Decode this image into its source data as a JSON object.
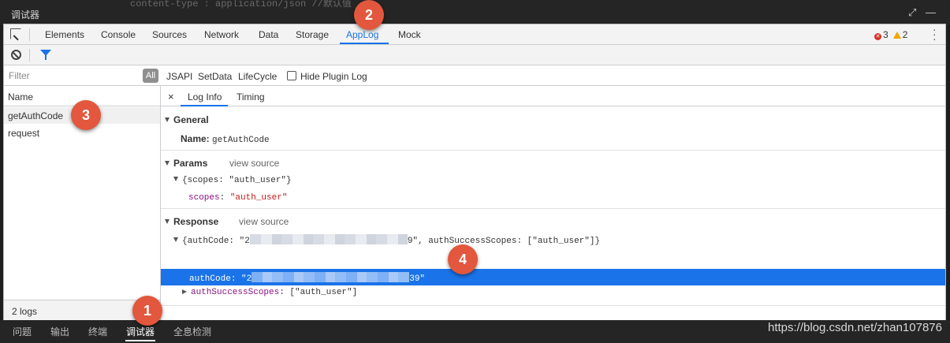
{
  "window": {
    "title": "调试器",
    "code_snippet": "content-type :  application/json  //默认值",
    "controls": [
      "expand-icon",
      "minimize-icon"
    ]
  },
  "devtools_tabs": [
    "Elements",
    "Console",
    "Sources",
    "Network",
    "Data",
    "Storage",
    "AppLog",
    "Mock"
  ],
  "active_tab": "AppLog",
  "status": {
    "errors": "3",
    "warnings": "2"
  },
  "filter": {
    "placeholder": "Filter",
    "all_label": "All",
    "types": [
      "JSAPI",
      "SetData",
      "LifeCycle"
    ],
    "hide_plugin_label": "Hide Plugin Log",
    "hide_plugin_checked": false
  },
  "list": {
    "header": "Name",
    "items": [
      "getAuthCode",
      "request"
    ],
    "selected": "getAuthCode",
    "footer": "2 logs"
  },
  "detail": {
    "close": "×",
    "tabs": [
      "Log Info",
      "Timing"
    ],
    "active_tab": "Log Info",
    "general": {
      "title": "General",
      "name_label": "Name:",
      "name_value": "getAuthCode"
    },
    "params": {
      "title": "Params",
      "view_source": "view source",
      "summary": "{scopes: \"auth_user\"}",
      "key": "scopes",
      "value": "\"auth_user\""
    },
    "response": {
      "title": "Response",
      "view_source": "view source",
      "summary_prefix": "{authCode: \"2",
      "summary_suffix": "9\", authSuccessScopes: [\"auth_user\"]}",
      "authcode_key": "authCode",
      "authcode_prefix": "\"2",
      "authcode_suffix": "39\"",
      "scopes_key": "authSuccessScopes",
      "scopes_value": "[\"auth_user\"]"
    }
  },
  "badges": [
    "1",
    "2",
    "3",
    "4"
  ],
  "bottom_tabs": [
    "问题",
    "输出",
    "终端",
    "调试器",
    "全息检测"
  ],
  "active_bottom_tab": "调试器",
  "watermark": "https://blog.csdn.net/zhan107876",
  "colors": {
    "accent": "#1a73e8",
    "badge": "#e2573d",
    "dark_bg": "#252526"
  }
}
